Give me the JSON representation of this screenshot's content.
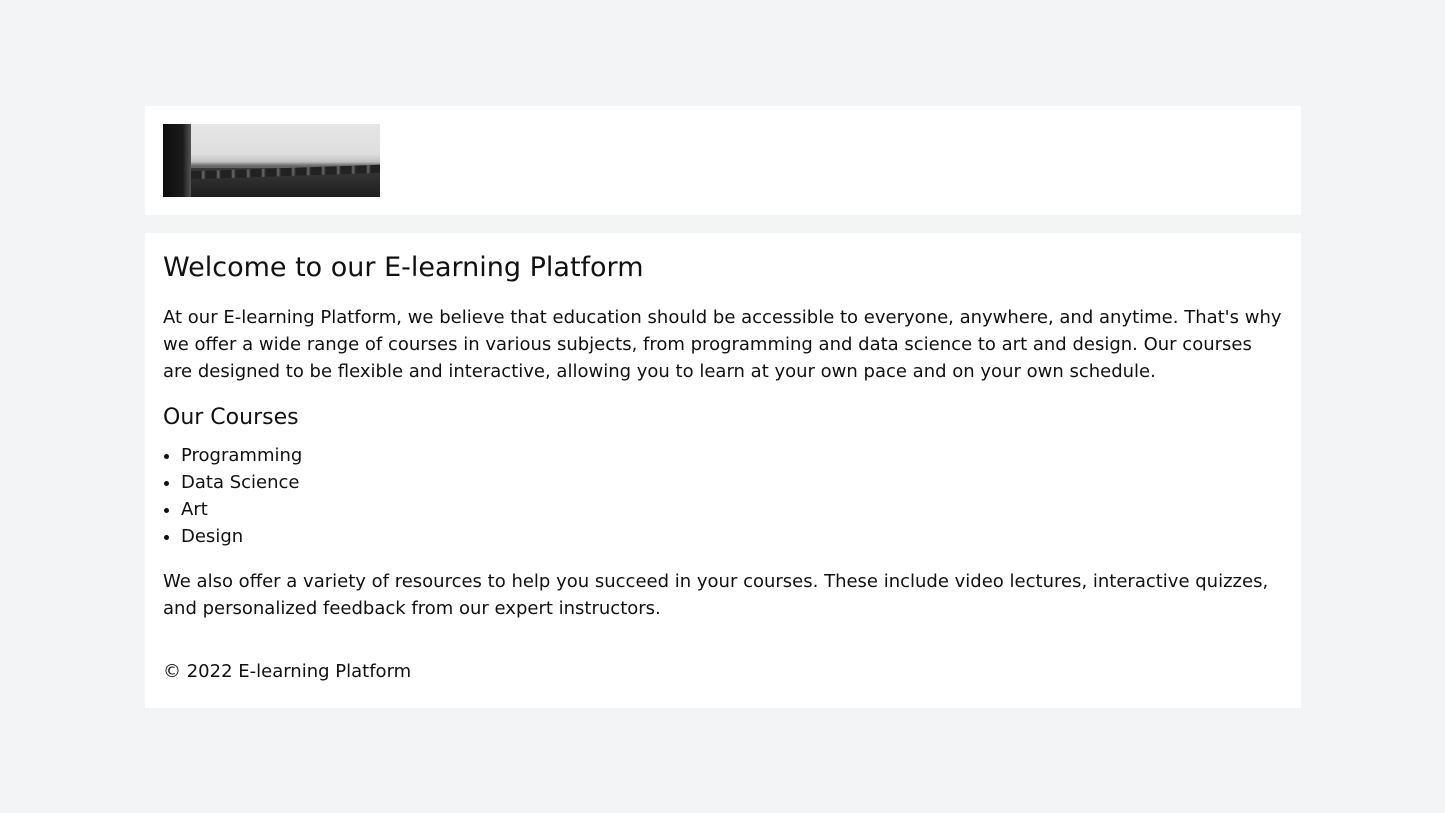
{
  "header": {
    "logo_icon": "logo-photo-icon"
  },
  "main": {
    "title": "Welcome to our E-learning Platform",
    "intro": "At our E-learning Platform, we believe that education should be accessible to everyone, anywhere, and anytime. That's why we offer a wide range of courses in various subjects, from programming and data science to art and design. Our courses are designed to be flexible and interactive, allowing you to learn at your own pace and on your own schedule.",
    "courses_heading": "Our Courses",
    "courses": [
      "Programming",
      "Data Science",
      "Art",
      "Design"
    ],
    "resources": "We also offer a variety of resources to help you succeed in your courses. These include video lectures, interactive quizzes, and personalized feedback from our expert instructors."
  },
  "footer": {
    "copyright": "© 2022 E-learning Platform"
  },
  "colors": {
    "background": "#f3f4f6",
    "card": "#ffffff",
    "text": "#111111"
  }
}
